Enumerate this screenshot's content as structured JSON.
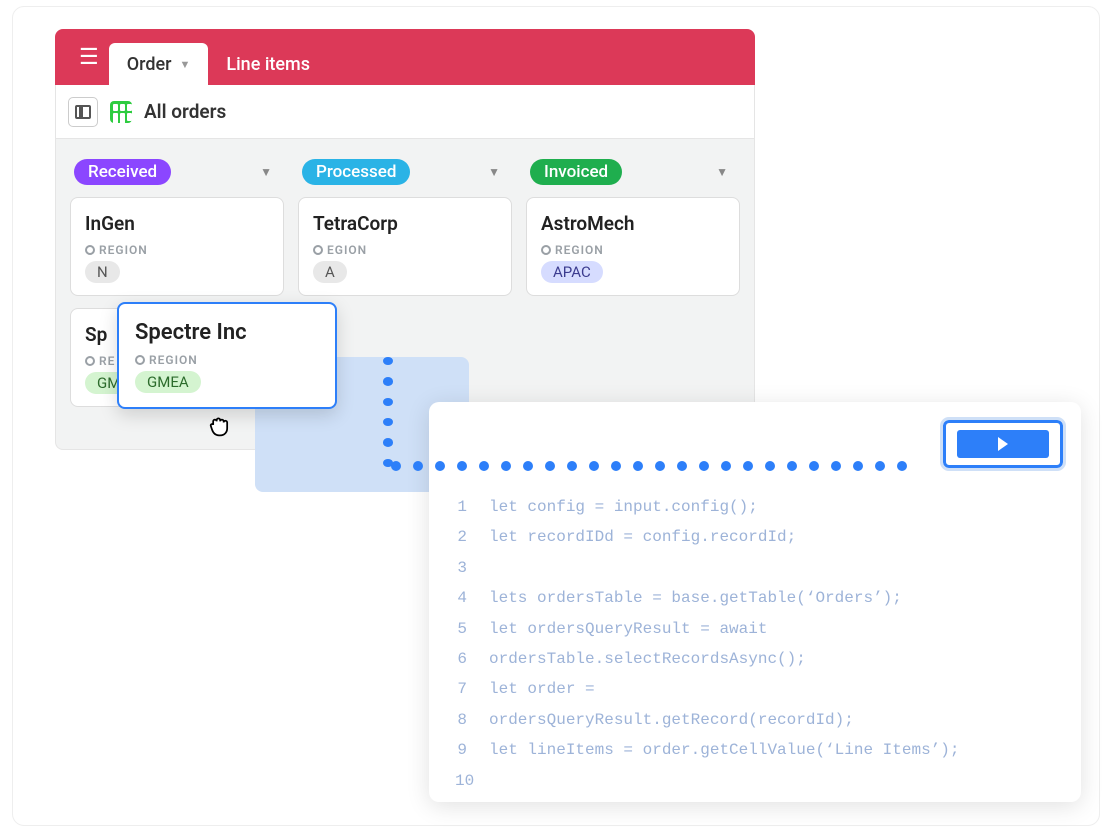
{
  "tabs": {
    "order": "Order",
    "line_items": "Line items"
  },
  "view": {
    "title": "All orders"
  },
  "columns": [
    {
      "label": "Received",
      "color": "purple"
    },
    {
      "label": "Processed",
      "color": "blue"
    },
    {
      "label": "Invoiced",
      "color": "green"
    }
  ],
  "cards": {
    "col0": [
      {
        "title": "InGen",
        "region_label": "REGION",
        "region_value": "N"
      },
      {
        "title": "Sp",
        "region_label": "RE",
        "region_value": "GMEA"
      }
    ],
    "col1": [
      {
        "title": "TetraCorp",
        "region_label": "EGION",
        "region_value": "A"
      }
    ],
    "col2": [
      {
        "title": "AstroMech",
        "region_label": "REGION",
        "region_value": "APAC"
      }
    ]
  },
  "drag_card": {
    "title": "Spectre Inc",
    "region_label": "REGION",
    "region_value": "GMEA"
  },
  "code": {
    "lines": [
      "let config = input.config();",
      "let recordIDd = config.recordId;",
      "",
      "lets ordersTable = base.getTable(‘Orders’);",
      "let ordersQueryResult = await",
      "ordersTable.selectRecordsAsync();",
      "let order =",
      "ordersQueryResult.getRecord(recordId);",
      "let lineItems = order.getCellValue(‘Line Items’);",
      ""
    ]
  }
}
